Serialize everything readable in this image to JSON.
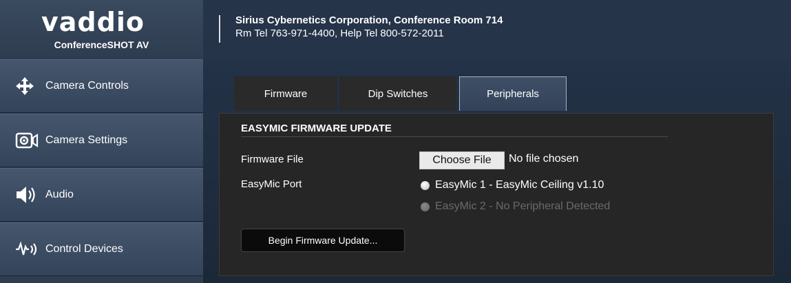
{
  "brand": {
    "logo_text": "vaddio",
    "product": "ConferenceSHOT AV"
  },
  "header": {
    "line1": "Sirius Cybernetics Corporation, Conference Room 714",
    "line2": "Rm Tel 763-971-4400, Help Tel 800-572-2011"
  },
  "sidebar": {
    "items": [
      {
        "label": "Camera Controls",
        "icon": "move-arrows-icon"
      },
      {
        "label": "Camera Settings",
        "icon": "camera-settings-icon"
      },
      {
        "label": "Audio",
        "icon": "speaker-icon"
      },
      {
        "label": "Control Devices",
        "icon": "control-devices-icon"
      }
    ]
  },
  "tabs": [
    {
      "label": "Firmware",
      "active": false
    },
    {
      "label": "Dip Switches",
      "active": false
    },
    {
      "label": "Peripherals",
      "active": true
    }
  ],
  "panel": {
    "title": "EASYMIC FIRMWARE UPDATE",
    "firmware_file_label": "Firmware File",
    "choose_file_label": "Choose File",
    "no_file_text": "No file chosen",
    "port_label": "EasyMic Port",
    "ports": [
      {
        "label": "EasyMic 1 - EasyMic Ceiling v1.10",
        "enabled": true
      },
      {
        "label": "EasyMic 2 - No Peripheral Detected",
        "enabled": false
      }
    ],
    "begin_button_label": "Begin Firmware Update..."
  }
}
